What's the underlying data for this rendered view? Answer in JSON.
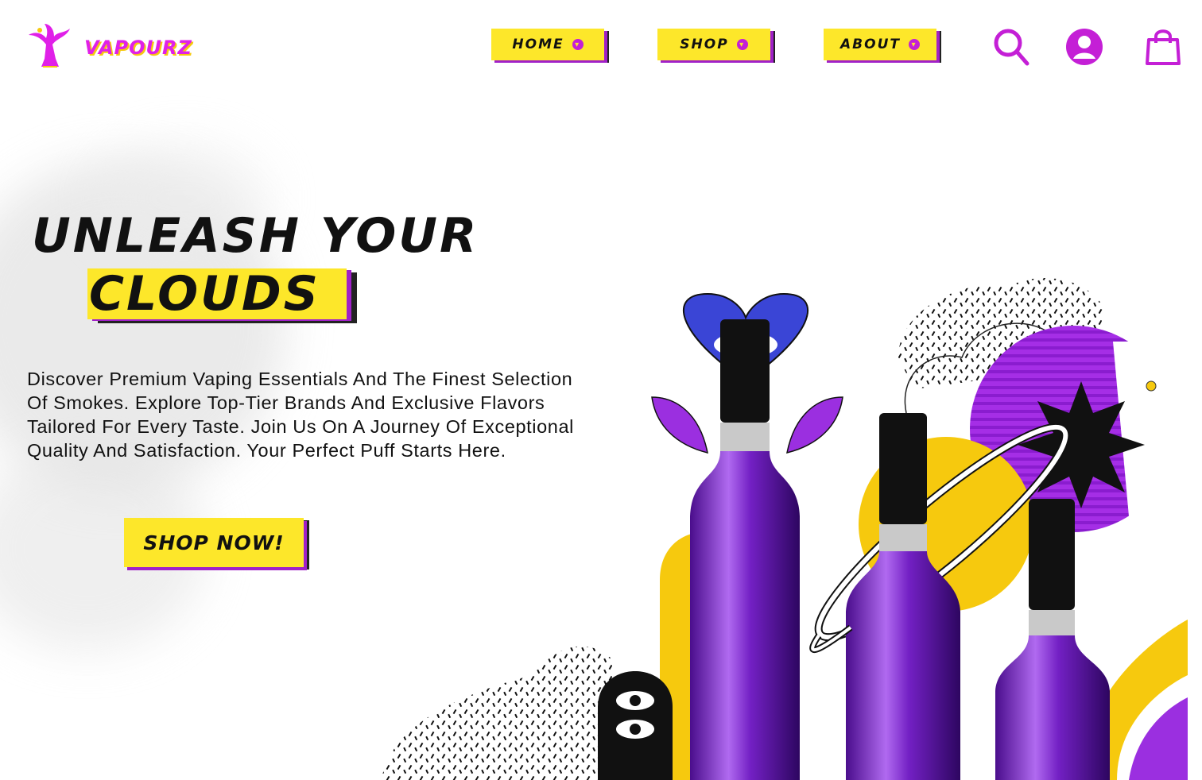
{
  "brand": {
    "name": "VAPOURZ"
  },
  "nav": [
    {
      "label": "HOME"
    },
    {
      "label": "SHOP"
    },
    {
      "label": "ABOUT"
    }
  ],
  "header_icons": [
    "search-icon",
    "user-account-icon",
    "shopping-bag-icon"
  ],
  "hero": {
    "title_line1": "UNLEASH YOUR",
    "title_line2": "CLOUDS",
    "description": "Discover Premium Vaping Essentials And The Finest Selection Of Smokes. Explore Top-Tier Brands And Exclusive Flavors Tailored For Every Taste. Join Us On A Journey Of Exceptional Quality And Satisfaction. Your Perfect Puff Starts Here.",
    "cta_label": "SHOP NOW!"
  },
  "colors": {
    "accent_yellow": "#fde72a",
    "accent_magenta": "#c41fd6",
    "accent_purple": "#a020c8",
    "text_dark": "#111111"
  }
}
